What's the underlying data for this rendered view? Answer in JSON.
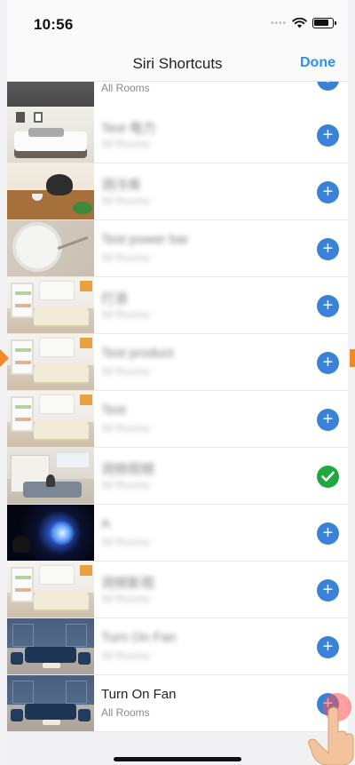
{
  "status_bar": {
    "time": "10:56"
  },
  "nav": {
    "title": "Siri Shortcuts",
    "done_label": "Done"
  },
  "rows": [
    {
      "title": "",
      "subtitle": "All Rooms",
      "state": "add"
    },
    {
      "title": "Test 电力",
      "subtitle": "All Rooms",
      "state": "add"
    },
    {
      "title": "测冷库",
      "subtitle": "All Rooms",
      "state": "add"
    },
    {
      "title": "Test power bar",
      "subtitle": "All Rooms",
      "state": "add"
    },
    {
      "title": "打浪",
      "subtitle": "All Rooms",
      "state": "add"
    },
    {
      "title": "Test product",
      "subtitle": "All Rooms",
      "state": "add"
    },
    {
      "title": "Test",
      "subtitle": "All Rooms",
      "state": "add"
    },
    {
      "title": "测频视频",
      "subtitle": "All Rooms",
      "state": "added"
    },
    {
      "title": "A",
      "subtitle": "All Rooms",
      "state": "add"
    },
    {
      "title": "测频影视",
      "subtitle": "All Rooms",
      "state": "add"
    },
    {
      "title": "Turn On Fan",
      "subtitle": "All Rooms",
      "state": "add"
    },
    {
      "title": "Turn On Fan",
      "subtitle": "All Rooms",
      "state": "add"
    }
  ],
  "icons": {
    "add": "plus-circle-icon",
    "added": "check-circle-icon",
    "wifi": "wifi-icon",
    "battery": "battery-icon"
  },
  "colors": {
    "accent": "#2f8df4",
    "add_button": "#3a82d6",
    "added_button": "#1ea83f",
    "tutorial_marker": "#f08a24"
  }
}
